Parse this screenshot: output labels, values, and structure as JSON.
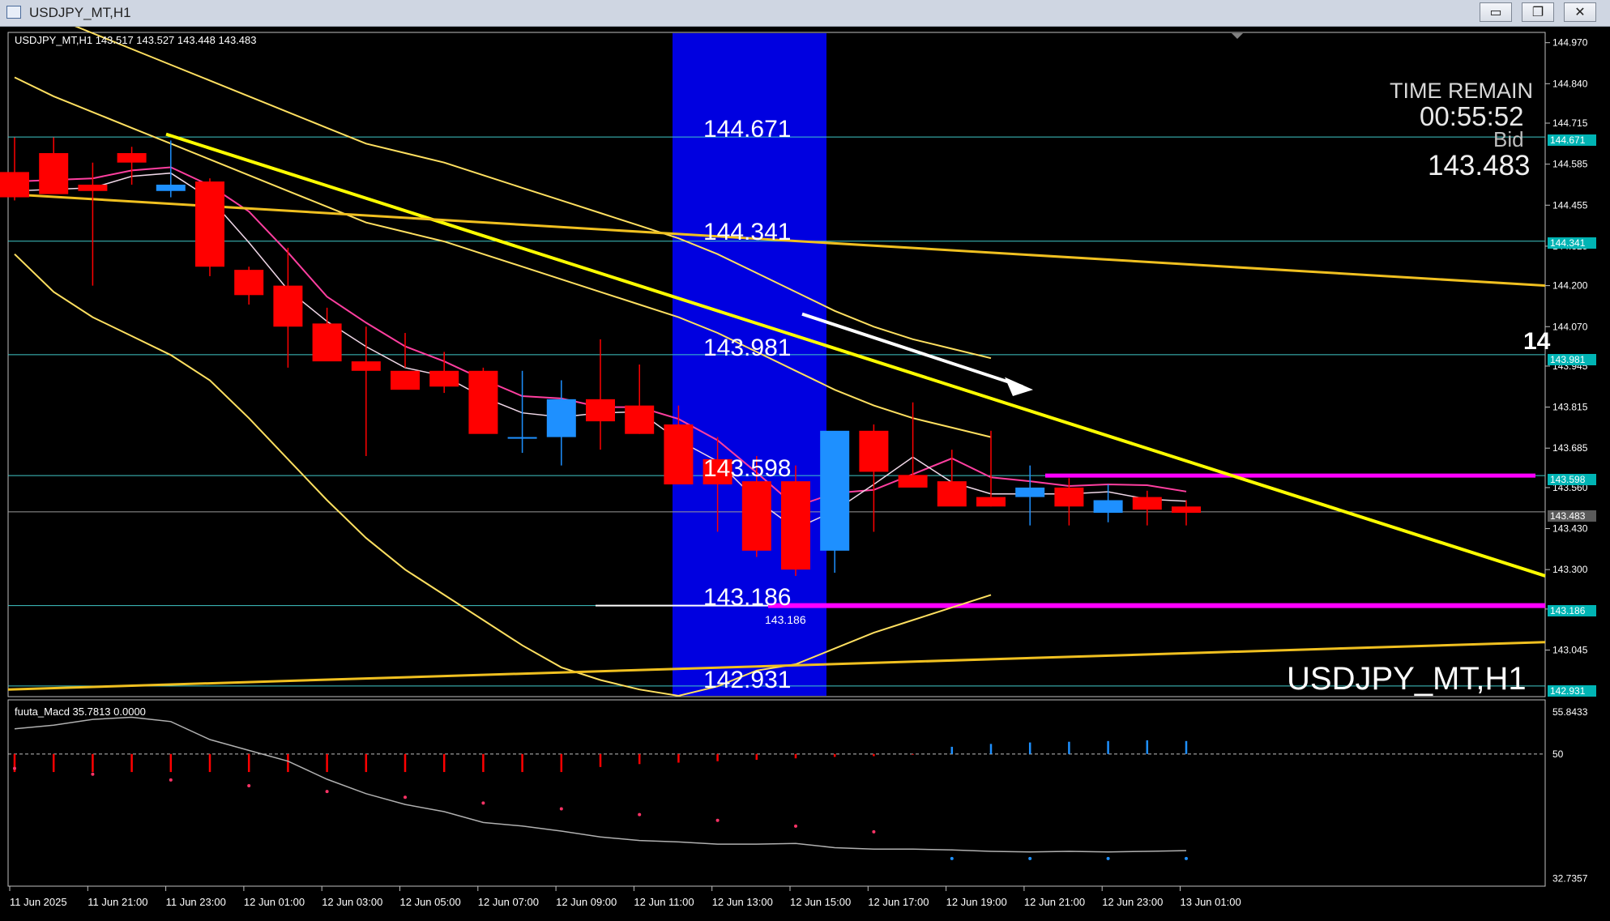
{
  "window": {
    "title": "USDJPY_MT,H1",
    "minimize": "▭",
    "restore": "❐",
    "close": "✕"
  },
  "chart": {
    "header": "USDJPY_MT,H1  143.517 143.527 143.448 143.483",
    "watermark": "USDJPY_MT,H1",
    "time_remain_label": "TIME REMAIN",
    "time_remain_value": "00:55:52",
    "bid_label": "Bid",
    "bid_value": "143.483",
    "cut_label": "14",
    "level_labels": [
      "144.671",
      "144.341",
      "143.981",
      "143.598",
      "143.186",
      "142.931"
    ],
    "low_label_small": "143.186"
  },
  "colors": {
    "bull": "#1e90ff",
    "bear": "#ff0000",
    "band": "#ffff00",
    "highlight": "#0000e0",
    "magenta": "#ff00ff",
    "level": "#40c8c8"
  },
  "chart_data": [
    {
      "type": "candlestick",
      "title": "USDJPY_MT,H1",
      "x": [
        "11 Jun 2025",
        "11 Jun 20:00",
        "11 Jun 21:00",
        "11 Jun 22:00",
        "11 Jun 23:00",
        "12 Jun 00:00",
        "12 Jun 01:00",
        "12 Jun 02:00",
        "12 Jun 03:00",
        "12 Jun 04:00",
        "12 Jun 05:00",
        "12 Jun 06:00",
        "12 Jun 07:00",
        "12 Jun 08:00",
        "12 Jun 09:00",
        "12 Jun 10:00",
        "12 Jun 11:00",
        "12 Jun 12:00",
        "12 Jun 13:00",
        "12 Jun 14:00",
        "12 Jun 15:00",
        "12 Jun 16:00",
        "12 Jun 17:00",
        "12 Jun 18:00",
        "12 Jun 19:00",
        "12 Jun 20:00",
        "12 Jun 21:00",
        "12 Jun 22:00",
        "12 Jun 23:00",
        "13 Jun 00:00",
        "13 Jun 01:00"
      ],
      "open": [
        144.56,
        144.62,
        144.52,
        144.62,
        144.5,
        144.53,
        144.25,
        144.2,
        144.08,
        143.96,
        143.93,
        143.93,
        143.93,
        143.72,
        143.72,
        143.84,
        143.82,
        143.76,
        143.65,
        143.58,
        143.58,
        143.36,
        143.74,
        143.6,
        143.58,
        143.53,
        143.53,
        143.56,
        143.48,
        143.53,
        143.5
      ],
      "high": [
        144.67,
        144.67,
        144.59,
        144.64,
        144.66,
        144.54,
        144.26,
        144.32,
        144.13,
        144.07,
        144.05,
        143.99,
        143.94,
        143.93,
        143.9,
        144.03,
        143.95,
        143.82,
        143.72,
        143.66,
        143.63,
        143.5,
        143.76,
        143.83,
        143.68,
        143.74,
        143.63,
        143.59,
        143.57,
        143.55,
        143.52
      ],
      "low": [
        144.47,
        144.51,
        144.2,
        144.52,
        144.48,
        144.23,
        144.14,
        143.94,
        143.97,
        143.66,
        143.94,
        143.86,
        143.83,
        143.67,
        143.63,
        143.68,
        143.73,
        143.57,
        143.42,
        143.34,
        143.28,
        143.29,
        143.42,
        143.57,
        143.56,
        143.5,
        143.44,
        143.44,
        143.45,
        143.44,
        143.44
      ],
      "close": [
        144.48,
        144.49,
        144.5,
        144.59,
        144.52,
        144.26,
        144.17,
        144.07,
        143.96,
        143.93,
        143.87,
        143.88,
        143.73,
        143.72,
        143.84,
        143.77,
        143.73,
        143.57,
        143.57,
        143.36,
        143.3,
        143.74,
        143.61,
        143.56,
        143.5,
        143.5,
        143.56,
        143.5,
        143.52,
        143.49,
        143.48
      ],
      "ylim": [
        142.9,
        145.0
      ],
      "y_ticks": [
        "144.970",
        "144.840",
        "144.715",
        "144.585",
        "144.455",
        "144.325",
        "144.200",
        "144.070",
        "143.945",
        "143.815",
        "143.685",
        "143.560",
        "143.430",
        "143.300",
        "143.175",
        "143.045"
      ],
      "x_ticks": [
        "11 Jun 2025",
        "11 Jun 21:00",
        "11 Jun 23:00",
        "12 Jun 01:00",
        "12 Jun 03:00",
        "12 Jun 05:00",
        "12 Jun 07:00",
        "12 Jun 09:00",
        "12 Jun 11:00",
        "12 Jun 13:00",
        "12 Jun 15:00",
        "12 Jun 17:00",
        "12 Jun 19:00",
        "12 Jun 21:00",
        "12 Jun 23:00",
        "13 Jun 01:00"
      ],
      "horizontal_levels": [
        "144.671",
        "144.341",
        "143.981",
        "143.598",
        "143.483",
        "143.186",
        "142.931"
      ],
      "bands": {
        "upper": [
          144.86,
          144.8,
          144.75,
          144.7,
          144.65,
          144.6,
          144.55,
          144.5,
          144.45,
          144.4,
          144.37,
          144.34,
          144.3,
          144.26,
          144.22,
          144.18,
          144.14,
          144.1,
          144.05,
          143.99,
          143.93,
          143.87,
          143.82,
          143.78,
          143.75,
          143.72
        ],
        "lower": [
          144.3,
          144.18,
          144.1,
          144.04,
          143.98,
          143.9,
          143.78,
          143.65,
          143.52,
          143.4,
          143.3,
          143.22,
          143.14,
          143.06,
          142.99,
          142.95,
          142.92,
          142.9,
          142.93,
          142.98,
          143.0,
          143.05,
          143.1,
          143.14,
          143.18,
          143.22
        ]
      }
    },
    {
      "type": "histogram",
      "title": "fuuta_Macd 35.7813  0.0000",
      "y_ticks": [
        "55.8433",
        "50",
        "32.7357"
      ],
      "values": [
        47.5,
        47.5,
        47.5,
        47.5,
        47.5,
        47.5,
        47.5,
        47.5,
        47.5,
        47.5,
        47.5,
        47.5,
        47.5,
        47.5,
        47.5,
        48.2,
        48.6,
        48.8,
        49.0,
        49.2,
        49.4,
        49.6,
        49.7,
        49.9,
        51.0,
        51.4,
        51.6,
        51.7,
        51.8,
        51.9,
        51.8
      ],
      "signal": [
        53.5,
        54.0,
        54.8,
        55.1,
        54.5,
        52.0,
        50.5,
        49.0,
        46.5,
        44.5,
        43.0,
        42.0,
        40.5,
        40.0,
        39.3,
        38.5,
        38.0,
        37.8,
        37.5,
        37.5,
        37.6,
        37.0,
        36.8,
        36.8,
        36.7,
        36.5,
        36.4,
        36.5,
        36.4,
        36.5,
        36.6
      ]
    }
  ]
}
